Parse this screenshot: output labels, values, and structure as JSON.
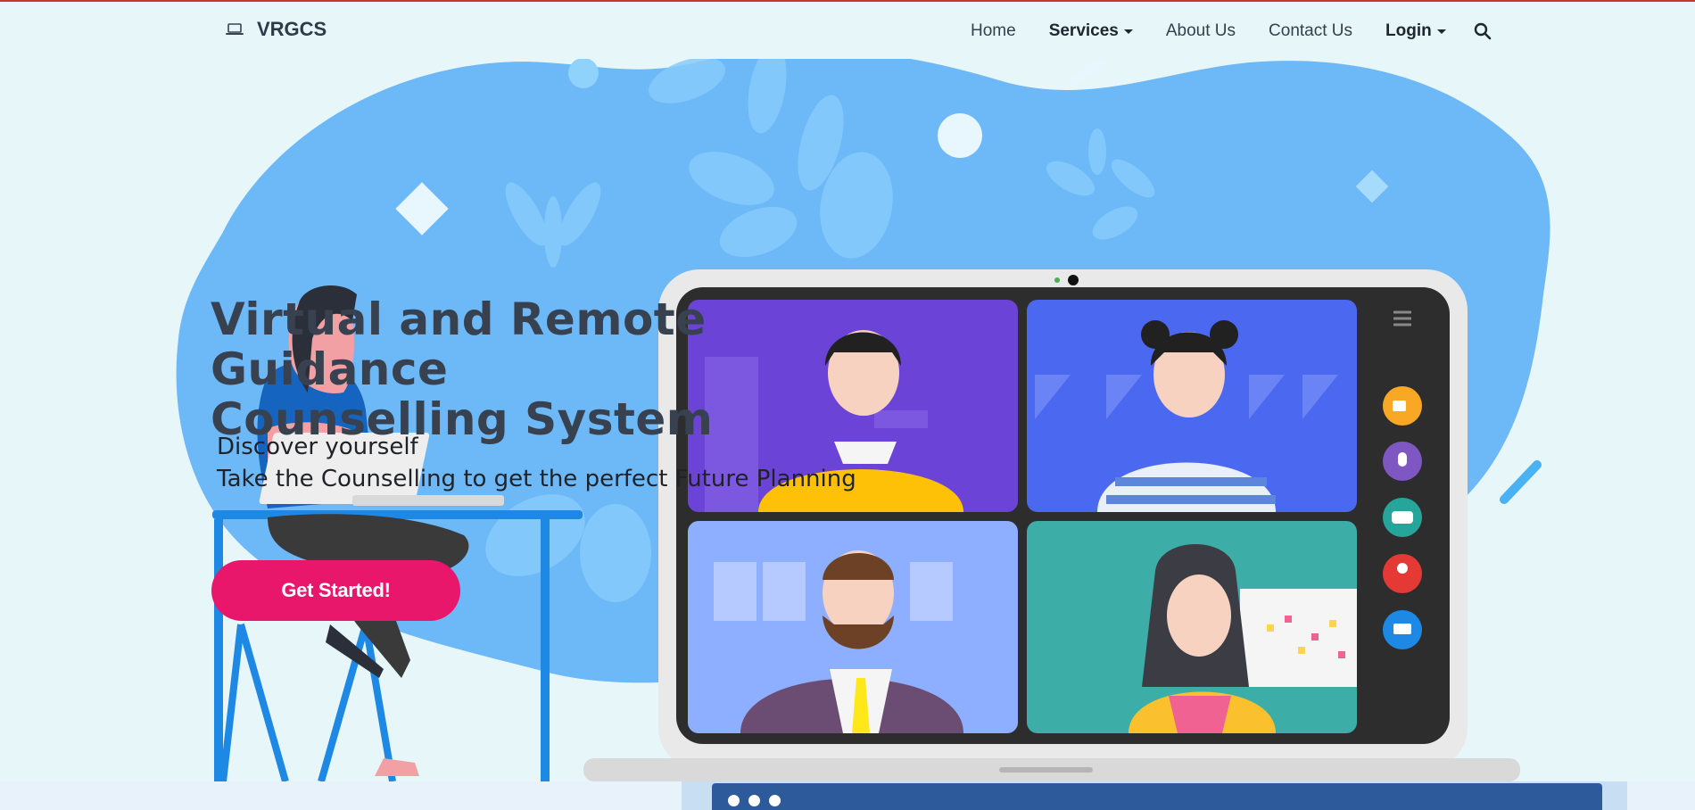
{
  "brand": {
    "name": "VRGCS",
    "icon": "laptop-icon"
  },
  "nav": {
    "home": "Home",
    "services": "Services",
    "about": "About Us",
    "contact": "Contact Us",
    "login": "Login",
    "search_icon": "search-icon"
  },
  "hero": {
    "title_line1": "Virtual and Remote Guidance",
    "title_line2": "Counselling System",
    "sub_line1": "Discover yourself",
    "sub_line2": "Take the Counselling to get the perfect Future Planning",
    "cta": "Get Started!"
  },
  "colors": {
    "page_bg": "#e6f6f9",
    "blob": "#6db8f7",
    "accent": "#e8176b",
    "heading": "#38414f"
  }
}
